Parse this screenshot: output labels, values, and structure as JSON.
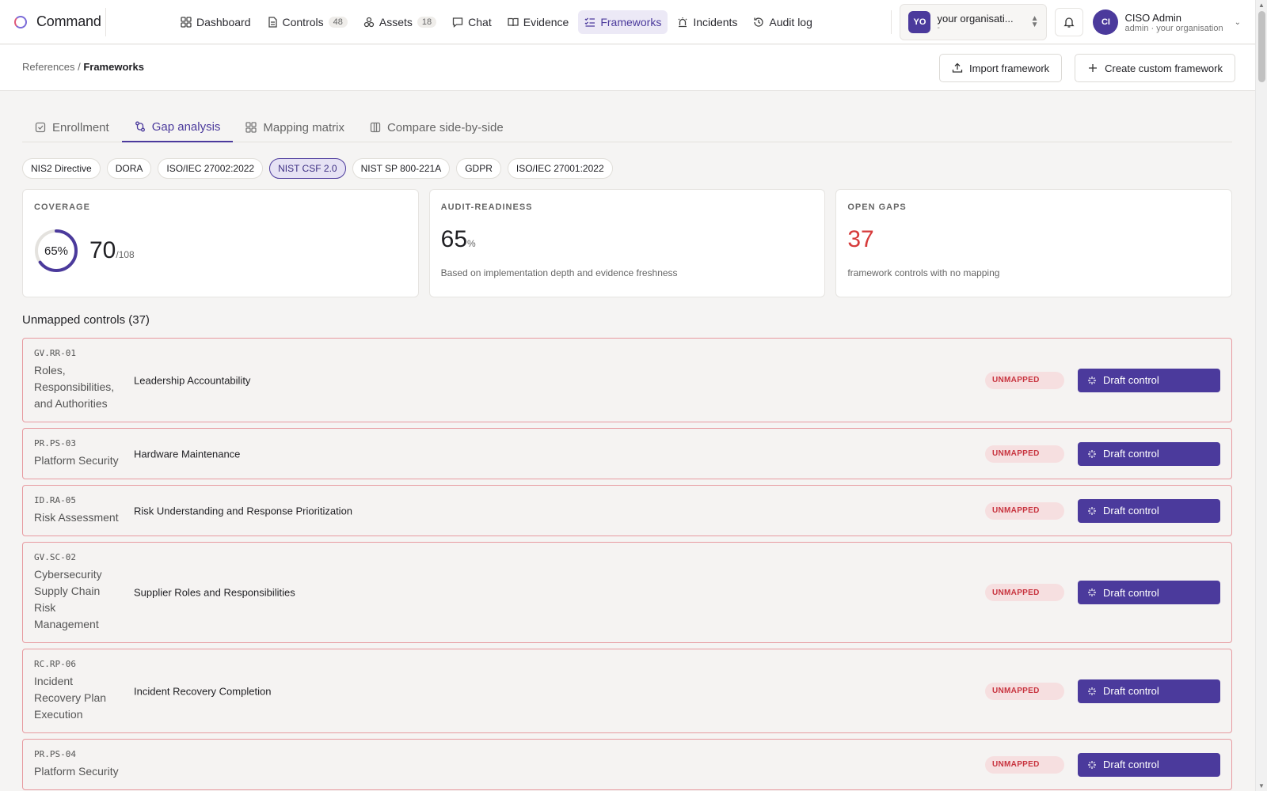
{
  "app": {
    "name": "Command"
  },
  "nav": [
    {
      "label": "Dashboard",
      "icon": "grid-icon",
      "count": ""
    },
    {
      "label": "Controls",
      "icon": "document-icon",
      "count": "48"
    },
    {
      "label": "Assets",
      "icon": "boxes-icon",
      "count": "18"
    },
    {
      "label": "Chat",
      "icon": "chat-icon",
      "count": ""
    },
    {
      "label": "Evidence",
      "icon": "book-icon",
      "count": ""
    },
    {
      "label": "Frameworks",
      "icon": "checklist-icon",
      "count": "",
      "active": true
    },
    {
      "label": "Incidents",
      "icon": "siren-icon",
      "count": ""
    },
    {
      "label": "Audit log",
      "icon": "history-icon",
      "count": ""
    }
  ],
  "org": {
    "initials": "YO",
    "name": "your organisati...",
    "sub": "-"
  },
  "user": {
    "initials": "CI",
    "name": "CISO Admin",
    "sub": "admin · your organisation"
  },
  "breadcrumb": {
    "parent": "References",
    "separator": " / ",
    "current": "Frameworks"
  },
  "actions": {
    "import_label": "Import framework",
    "create_label": "Create custom framework"
  },
  "tabs": [
    {
      "label": "Enrollment",
      "icon": "checkbox-icon"
    },
    {
      "label": "Gap analysis",
      "icon": "git-compare-icon",
      "active": true
    },
    {
      "label": "Mapping matrix",
      "icon": "grid-icon"
    },
    {
      "label": "Compare side-by-side",
      "icon": "columns-icon"
    }
  ],
  "frameworks": [
    {
      "label": "NIS2 Directive"
    },
    {
      "label": "DORA"
    },
    {
      "label": "ISO/IEC 27002:2022"
    },
    {
      "label": "NIST CSF 2.0",
      "active": true
    },
    {
      "label": "NIST SP 800-221A"
    },
    {
      "label": "GDPR"
    },
    {
      "label": "ISO/IEC 27001:2022"
    }
  ],
  "stats": {
    "coverage": {
      "label": "COVERAGE",
      "percent_text": "65%",
      "percent": 65,
      "mapped": "70",
      "total": "/108"
    },
    "audit": {
      "label": "AUDIT-READINESS",
      "value": "65",
      "unit": "%",
      "note": "Based on implementation depth and evidence freshness"
    },
    "gaps": {
      "label": "OPEN GAPS",
      "value": "37",
      "note": "framework controls with no mapping"
    }
  },
  "list": {
    "title": "Unmapped controls (37)",
    "badge_label": "UNMAPPED",
    "button_label": "Draft control",
    "rows": [
      {
        "id": "GV.RR-01",
        "category": "Roles, Responsibilities, and Authorities",
        "title": "Leadership Accountability"
      },
      {
        "id": "PR.PS-03",
        "category": "Platform Security",
        "title": "Hardware Maintenance"
      },
      {
        "id": "ID.RA-05",
        "category": "Risk Assessment",
        "title": "Risk Understanding and Response Prioritization"
      },
      {
        "id": "GV.SC-02",
        "category": "Cybersecurity Supply Chain Risk Management",
        "title": "Supplier Roles and Responsibilities"
      },
      {
        "id": "RC.RP-06",
        "category": "Incident Recovery Plan Execution",
        "title": "Incident Recovery Completion"
      },
      {
        "id": "PR.PS-04",
        "category": "Platform Security",
        "title": ""
      }
    ]
  },
  "colors": {
    "accent": "#4b3a9c",
    "danger": "#d63b3b",
    "danger_border": "#e79aa0"
  }
}
